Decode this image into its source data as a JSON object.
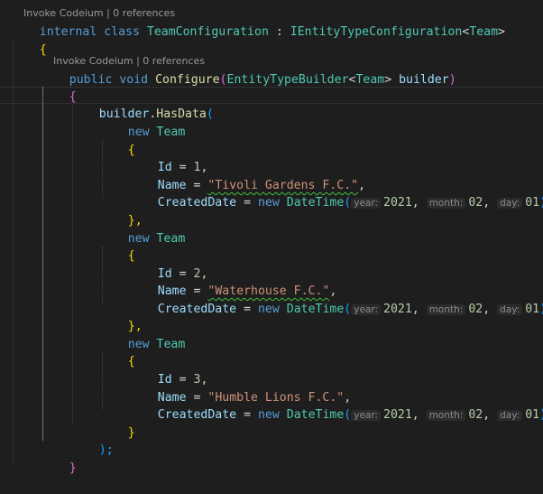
{
  "codelens": {
    "top_partial": "Invoke Codeium | 0 references",
    "method": "Invoke Codeium | 0 references"
  },
  "code": {
    "class_line": {
      "kw_internal": "internal",
      "kw_class": "class",
      "class_name": "TeamConfiguration",
      "colon": ":",
      "interface": "IEntityTypeConfiguration",
      "lt": "<",
      "generic_arg": "Team",
      "gt": ">"
    },
    "open_brace": "{",
    "method_line": {
      "kw_public": "public",
      "kw_void": "void",
      "method_name": "Configure",
      "paren_open": "(",
      "param_type": "EntityTypeBuilder",
      "lt": "<",
      "param_generic": "Team",
      "gt": ">",
      "param_name": "builder",
      "paren_close": ")"
    },
    "method_open_brace": "{",
    "hasdata_line": {
      "receiver": "builder",
      "dot": ".",
      "method": "HasData",
      "paren": "("
    },
    "kw_new": "new",
    "entity_type": "Team",
    "datetime_type": "DateTime",
    "open_brace_inner": "{",
    "close_brace_comma": "},",
    "close_brace": "}",
    "prop_id": "Id",
    "prop_name": "Name",
    "prop_created": "CreatedDate",
    "equals": "=",
    "comma": ",",
    "close_paren": ")",
    "hint_year": "year:",
    "hint_month": "month:",
    "hint_day": "day:",
    "teams": [
      {
        "id": "1",
        "name": "\"Tivoli Gardens F.C.\"",
        "year": "2021",
        "month": "02",
        "day": "01"
      },
      {
        "id": "2",
        "name": "\"Waterhouse F.C.\"",
        "year": "2021",
        "month": "02",
        "day": "01"
      },
      {
        "id": "3",
        "name": "\"Humble Lions F.C.\"",
        "year": "2021",
        "month": "02",
        "day": "01"
      }
    ],
    "hasdata_close": ");",
    "method_close_brace": "}"
  },
  "colors": {
    "background": "#1e1e1e",
    "keyword": "#569cd6",
    "type": "#4ec9b0",
    "function": "#dcdcaa",
    "variable": "#9cdcfe",
    "string": "#ce9178",
    "number": "#b5cea8",
    "bracket_1": "#ffd700",
    "bracket_2": "#da70d6",
    "bracket_3": "#179fff"
  }
}
